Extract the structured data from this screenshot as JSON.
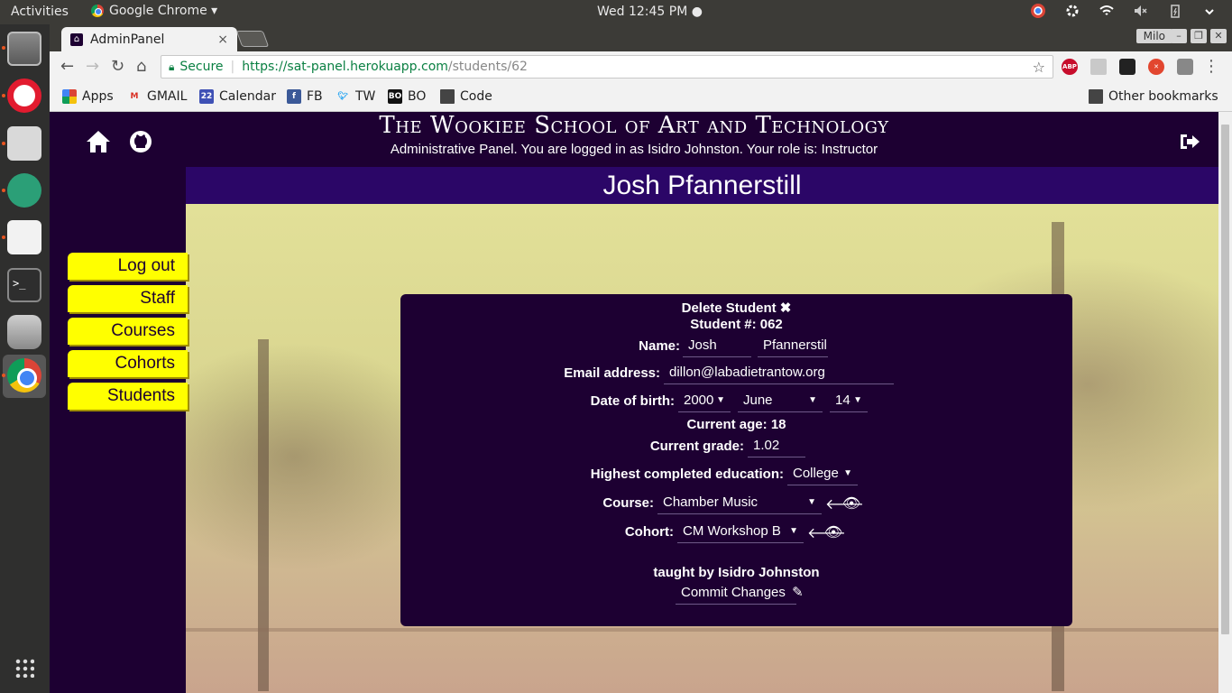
{
  "os": {
    "activities_label": "Activities",
    "app_label": "Google Chrome ▾",
    "clock": "Wed 12:45 PM ●",
    "dock_items": [
      "files-icon",
      "opera-icon",
      "slack-icon",
      "atom-icon",
      "text-editor-icon",
      "terminal-icon",
      "database-icon",
      "chrome-icon",
      "app-grid-icon"
    ]
  },
  "browser": {
    "tab_title": "AdminPanel",
    "tab_close": "×",
    "user_chip": "Milo",
    "secure_label": "Secure",
    "url_scheme_host": "https://sat-panel.herokuapp.com",
    "url_path": "/students/62",
    "bookmarks": [
      {
        "label": "Apps",
        "icon": "apps-grid-icon"
      },
      {
        "label": "GMAIL",
        "icon": "gmail-icon"
      },
      {
        "label": "Calendar",
        "icon": "calendar-icon"
      },
      {
        "label": "FB",
        "icon": "facebook-icon"
      },
      {
        "label": "TW",
        "icon": "twitter-icon"
      },
      {
        "label": "BO",
        "icon": "bo-icon"
      },
      {
        "label": "Code",
        "icon": "folder-icon"
      }
    ],
    "other_bookmarks": "Other bookmarks"
  },
  "site": {
    "title": "The Wookiee School of Art and Technology",
    "subtitle": "Administrative Panel. You are logged in as Isidro Johnston. Your role is: Instructor",
    "page_heading": "Josh Pfannerstill"
  },
  "nav": {
    "items": [
      "Log out",
      "Staff",
      "Courses",
      "Cohorts",
      "Students"
    ]
  },
  "student": {
    "delete_label": "Delete Student ✖",
    "number_label": "Student #: 062",
    "name_label": "Name:",
    "first_name": "Josh",
    "last_name": "Pfannerstil",
    "email_label": "Email address:",
    "email": "dillon@labadietrantow.org",
    "dob_label": "Date of birth:",
    "dob_year": "2000",
    "dob_month": "June",
    "dob_day": "14",
    "age_label": "Current age: 18",
    "grade_label": "Current grade:",
    "grade": "1.02",
    "education_label": "Highest completed education:",
    "education": "College",
    "course_label": "Course:",
    "course": "Chamber Music",
    "cohort_label": "Cohort:",
    "cohort": "CM Workshop B",
    "taught_by": "taught by Isidro Johnston",
    "commit_label": "Commit Changes"
  },
  "colors": {
    "page_bg": "#1d0032",
    "header_band": "#2b0667",
    "nav_button": "#ffff00"
  }
}
